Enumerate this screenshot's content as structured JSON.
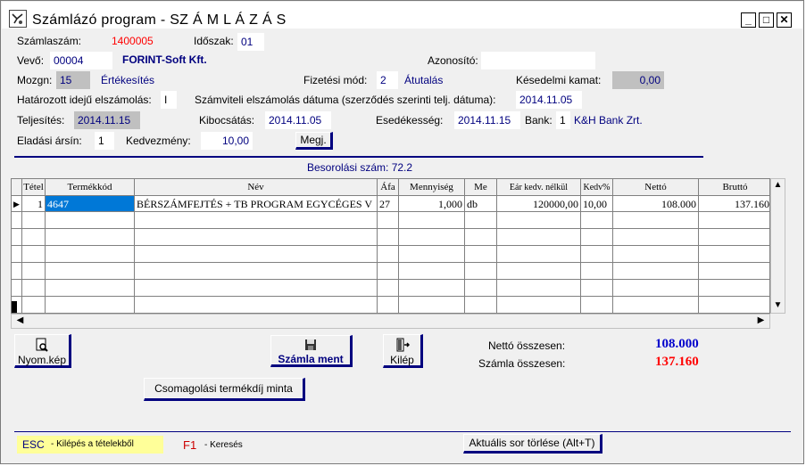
{
  "window": {
    "title": "Számlázó program - SZ Á M L Á Z Á S",
    "min": "_",
    "max": "□",
    "close": "✕"
  },
  "form": {
    "szamlaszam_label": "Számlaszám:",
    "szamlaszam_value": "1400005",
    "idoszak_label": "Időszak:",
    "idoszak_value": "01",
    "vevo_label": "Vevő:",
    "vevo_code": "00004",
    "vevo_name": "FORINT-Soft Kft.",
    "azonosito_label": "Azonosító:",
    "azonosito_value": "",
    "mozgn_label": "Mozgn:",
    "mozgn_code": "15",
    "mozgn_name": "Értékesítés",
    "fizmod_label": "Fizetési mód:",
    "fizmod_code": "2",
    "fizmod_name": "Átutalás",
    "kesedelmi_label": "Késedelmi kamat:",
    "kesedelmi_value": "0,00",
    "hatarozott_label": "Határozott idejű elszámolás:",
    "hatarozott_value": "I",
    "szamviteli_label": "Számviteli elszámolás dátuma (szerződés szerinti telj. dátuma):",
    "szamviteli_value": "2014.11.05",
    "teljesites_label": "Teljesítés:",
    "teljesites_value": "2014.11.15",
    "kibocsatas_label": "Kibocsátás:",
    "kibocsatas_value": "2014.11.05",
    "esedekesseg_label": "Esedékesség:",
    "esedekesseg_value": "2014.11.15",
    "bank_label": "Bank:",
    "bank_code": "1",
    "bank_name": "K&H Bank Zrt.",
    "arsin_label": "Eladási ársín:",
    "arsin_value": "1",
    "kedvezmeny_label": "Kedvezmény:",
    "kedvezmeny_value": "10,00",
    "megj_label": "Megj.",
    "besorolas": "Besorolási szám: 72.2"
  },
  "table": {
    "headers": [
      "Tétel",
      "Termékkód",
      "Név",
      "Áfa",
      "Mennyiség",
      "Me",
      "Eár kedv. nélkül",
      "Kedv%",
      "Nettó",
      "Bruttó"
    ],
    "rows": [
      [
        "1",
        "4647",
        "BÉRSZÁMFEJTÉS + TB PROGRAM EGYCÉGES V",
        "27",
        "1,000",
        "db",
        "120000,00",
        "10,00",
        "108.000",
        "137.160"
      ]
    ]
  },
  "buttons": {
    "nyomkep": "Nyom.kép",
    "szamla_ment": "Számla ment",
    "kilep": "Kilép",
    "csomagolasi": "Csomagolási termékdíj minta",
    "aktualis": "Aktuális sor törlése (Alt+T)"
  },
  "totals": {
    "netto_label": "Nettó összesen:",
    "netto_value": "108.000",
    "szamla_label": "Számla összesen:",
    "szamla_value": "137.160"
  },
  "statusbar": {
    "esc_key": "ESC",
    "esc_text": "-  Kilépés a tételekből",
    "f1_key": "F1",
    "f1_text": "-  Keresés"
  },
  "colors": {
    "accent": "#00007f",
    "red": "#ff0000",
    "yellow": "#ffff99"
  }
}
